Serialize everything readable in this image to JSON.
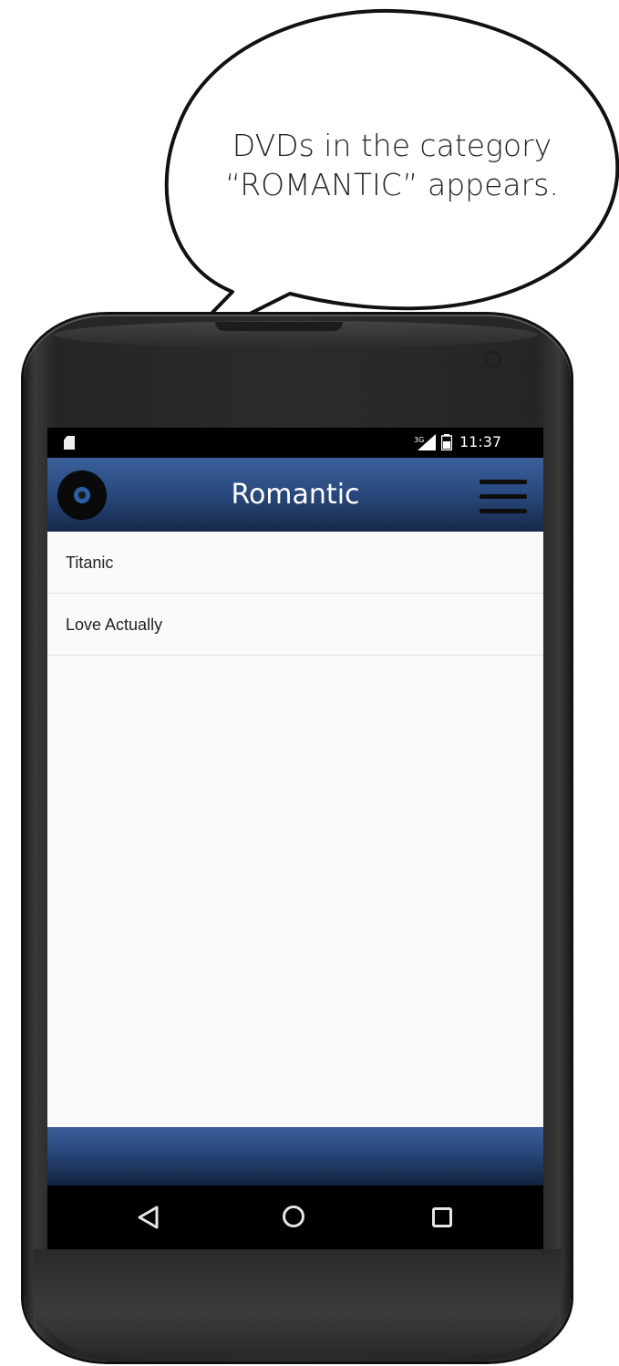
{
  "callout": {
    "line1": "DVDs in the category",
    "line2": "“ROMANTIC” appears."
  },
  "status_bar": {
    "time": "11:37",
    "icons": [
      "sd-card-icon",
      "signal-icon",
      "battery-icon"
    ]
  },
  "app_bar": {
    "title": "Romantic",
    "left_icon": "disc-icon",
    "right_icon": "hamburger-menu-icon",
    "color": "#2a4b80"
  },
  "list": {
    "items": [
      {
        "label": "Titanic"
      },
      {
        "label": "Love Actually"
      }
    ]
  },
  "nav_bar": {
    "buttons": [
      "back-icon",
      "home-icon",
      "recent-apps-icon"
    ]
  }
}
